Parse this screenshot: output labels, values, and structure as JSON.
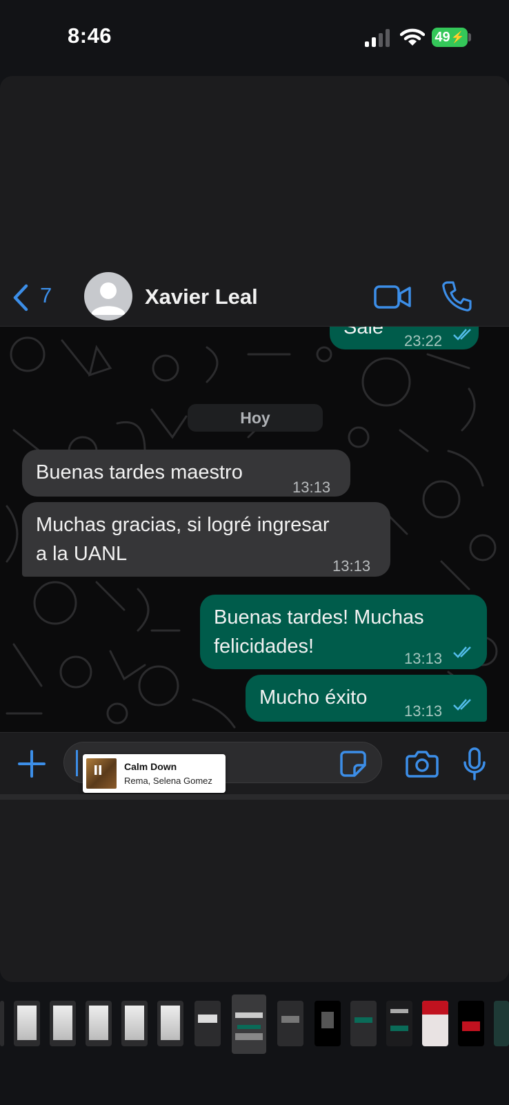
{
  "status_bar": {
    "time": "8:46",
    "battery": "49"
  },
  "header": {
    "back_count": "7",
    "contact_name": "Xavier Leal"
  },
  "chat": {
    "date_separator": "Hoy",
    "messages": [
      {
        "direction": "out",
        "text": "Sale",
        "time": "23:22",
        "read": true
      },
      {
        "direction": "in",
        "text": "Buenas tardes maestro",
        "time": "13:13"
      },
      {
        "direction": "in",
        "text_lines": [
          "Muchas gracias, si logré ingresar",
          "a la UANL"
        ],
        "time": "13:13"
      },
      {
        "direction": "out",
        "text_lines": [
          "Buenas tardes! Muchas",
          "felicidades!"
        ],
        "time": "13:13",
        "read": true
      },
      {
        "direction": "out",
        "text": "Mucho éxito",
        "time": "13:13",
        "read": true
      }
    ]
  },
  "now_playing": {
    "title": "Calm Down",
    "artist": "Rema, Selena Gomez"
  },
  "colors": {
    "accent_blue": "#3c8ee8",
    "outgoing_bubble": "#005c4b",
    "incoming_bubble": "#363638",
    "read_tick": "#53bdeb",
    "battery_green": "#34c759"
  }
}
